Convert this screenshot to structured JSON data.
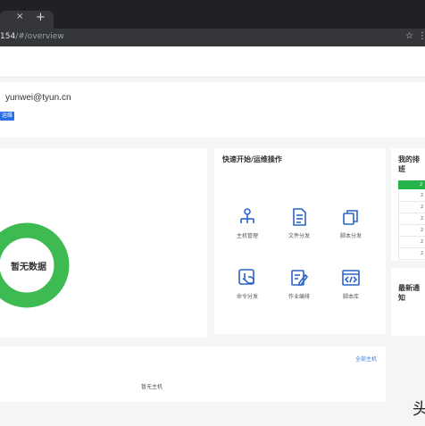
{
  "browser": {
    "tab_close": "×",
    "new_tab": "+",
    "url_host": "154",
    "url_path": "/#/overview",
    "star": "☆",
    "user_menu": "⋮"
  },
  "welcome": {
    "username": "yunwei@tyun.cn",
    "role_tag": "运维员"
  },
  "overview": {
    "empty_label": "暂无数据"
  },
  "quick_ops": {
    "title": "快速开始/运维操作",
    "items": [
      {
        "label": "主机管理",
        "icon": "host-icon"
      },
      {
        "label": "文件分发",
        "icon": "file-icon"
      },
      {
        "label": "脚本分发",
        "icon": "script-copy-icon"
      },
      {
        "label": "命令分发",
        "icon": "command-icon"
      },
      {
        "label": "作业编排",
        "icon": "job-edit-icon"
      },
      {
        "label": "脚本库",
        "icon": "code-icon"
      }
    ]
  },
  "rank": {
    "title": "我的排班",
    "rows": [
      "2",
      "2",
      "2",
      "2",
      "2",
      "2",
      "2"
    ]
  },
  "notice": {
    "title": "最新通知"
  },
  "hosts": {
    "all_link": "全部主机",
    "empty_label": "暂无主机"
  },
  "watermark": "头",
  "colors": {
    "accent": "#2a6fe8",
    "donut": "#3dba52",
    "rank_header": "#26b34b",
    "icon": "#2b63c9",
    "link": "#3b7be8"
  }
}
